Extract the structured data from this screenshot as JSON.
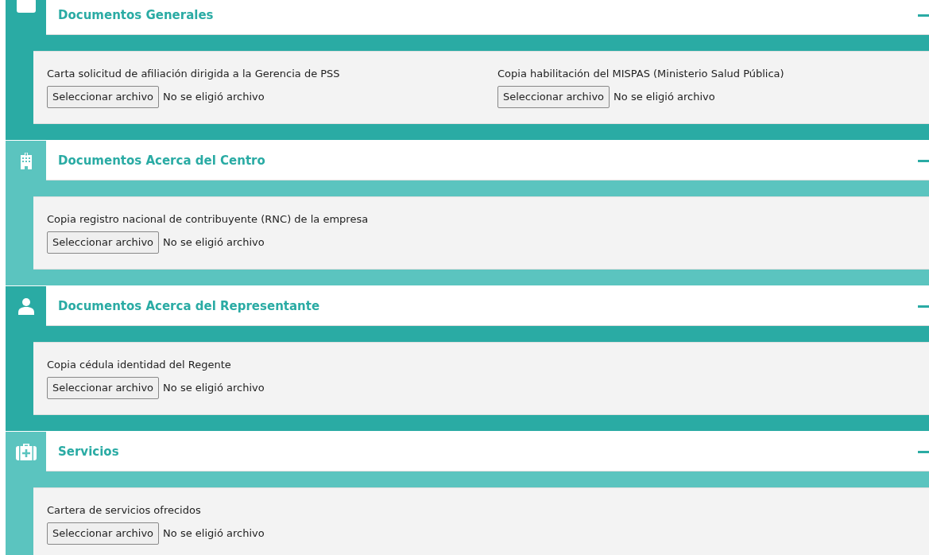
{
  "sections": [
    {
      "title": "Documentos Generales",
      "color": "#2aaba4",
      "expanded": true,
      "fields": [
        {
          "label": "Carta solicitud de afiliación dirigida a la Gerencia de PSS",
          "button": "Seleccionar archivo",
          "status": "No se eligió archivo"
        },
        {
          "label": "Copia habilitación del MISPAS (Ministerio Salud Pública)",
          "button": "Seleccionar archivo",
          "status": "No se eligió archivo"
        }
      ]
    },
    {
      "title": "Documentos Acerca del Centro",
      "color": "#5bc4bf",
      "expanded": true,
      "fields": [
        {
          "label": "Copia registro nacional de contribuyente (RNC) de la empresa",
          "button": "Seleccionar archivo",
          "status": "No se eligió archivo"
        }
      ]
    },
    {
      "title": "Documentos Acerca del Representante",
      "color": "#2aaba4",
      "expanded": true,
      "fields": [
        {
          "label": "Copia cédula identidad del Regente",
          "button": "Seleccionar archivo",
          "status": "No se eligió archivo"
        }
      ]
    },
    {
      "title": "Servicios",
      "color": "#5bc4bf",
      "expanded": true,
      "fields": [
        {
          "label": "Cartera de servicios ofrecidos",
          "button": "Seleccionar archivo",
          "status": "No se eligió archivo"
        }
      ]
    }
  ]
}
